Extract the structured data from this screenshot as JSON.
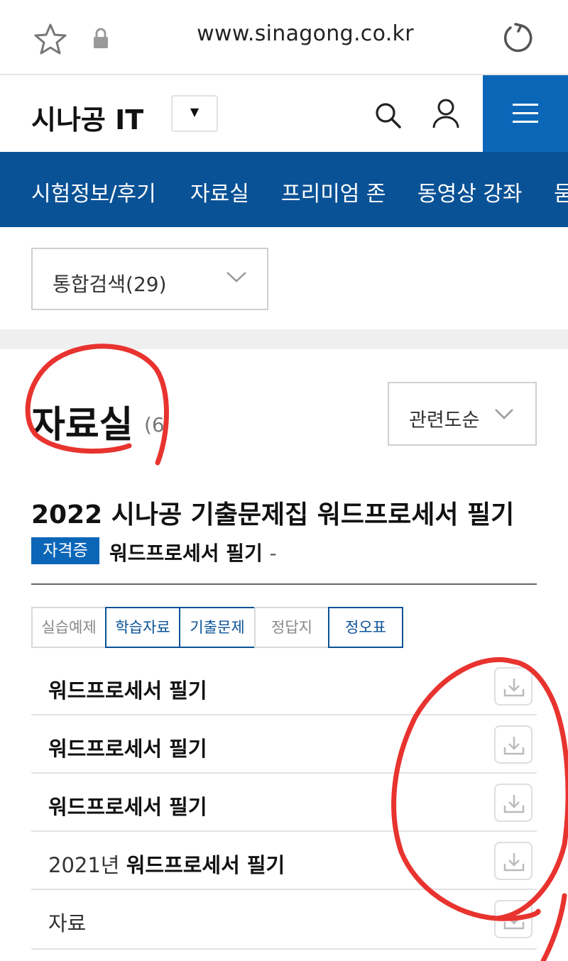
{
  "browser": {
    "url": "www.sinagong.co.kr",
    "icons": [
      "star-icon",
      "lock-icon",
      "reload-icon"
    ]
  },
  "header": {
    "logo": "시나공 IT",
    "dropdown_glyph": "▼",
    "icons": [
      "search-icon",
      "user-icon",
      "hamburger-menu-icon"
    ],
    "accent_color": "#0b66b8"
  },
  "nav": {
    "background_color": "#0a5296",
    "items": [
      {
        "label": "시험정보/후기"
      },
      {
        "label": "자료실"
      },
      {
        "label": "프리미엄 존"
      },
      {
        "label": "동영상 강좌"
      },
      {
        "label": "묻"
      }
    ]
  },
  "search_filter": {
    "selected": "통합검색(29)"
  },
  "section": {
    "title": "자료실",
    "count": "(6",
    "sort": {
      "selected": "관련도순"
    }
  },
  "book": {
    "title": "2022 시나공 기출문제집 워드프로세서 필기",
    "badge": "자격증",
    "subtitle": "워드프로세서 필기",
    "subtitle_suffix": "-"
  },
  "tabs": [
    {
      "label": "실습예제",
      "active": false
    },
    {
      "label": "학습자료",
      "active": true
    },
    {
      "label": "기출문제",
      "active": true
    },
    {
      "label": "정답지",
      "active": false
    },
    {
      "label": "정오표",
      "active": true
    }
  ],
  "materials": [
    {
      "prefix": "",
      "title": "워드프로세서 필기"
    },
    {
      "prefix": "",
      "title": "워드프로세서 필기"
    },
    {
      "prefix": "",
      "title": "워드프로세서 필기"
    },
    {
      "prefix": "2021년",
      "title": "워드프로세서 필기"
    },
    {
      "prefix": "자료",
      "title": ""
    }
  ],
  "annotation_color": "#e8332f"
}
